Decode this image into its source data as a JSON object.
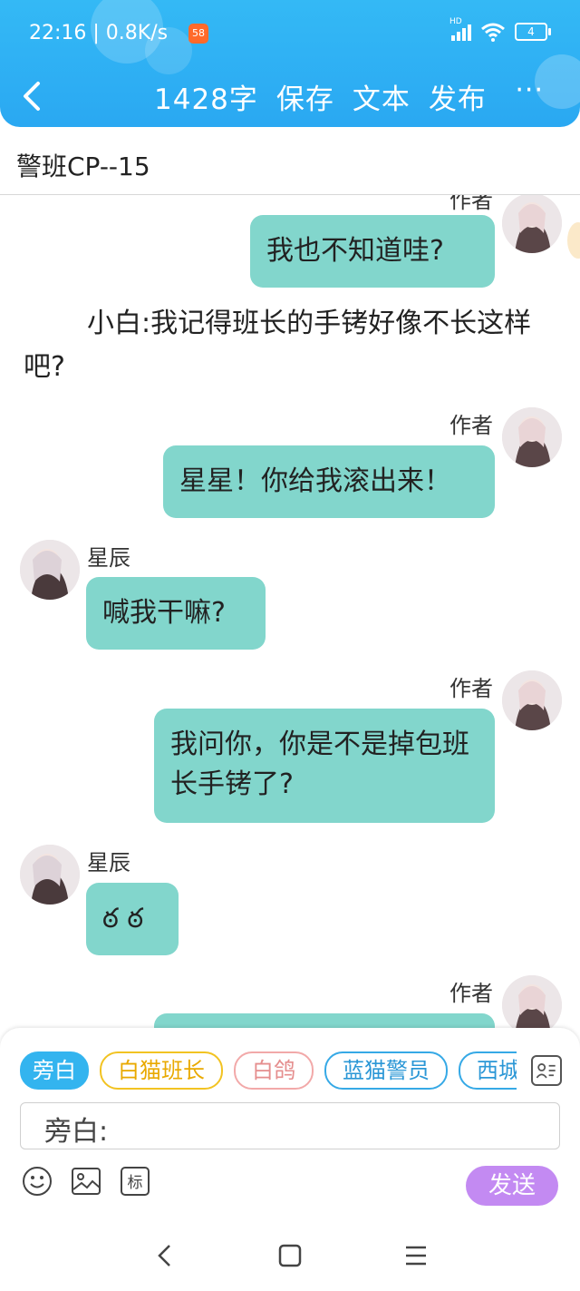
{
  "status_bar": {
    "time": "22:16 | 0.8K/s",
    "app_badge": "58",
    "hd": "HD",
    "battery": "4"
  },
  "toolbar": {
    "word_count": "1428字",
    "save": "保存",
    "text": "文本",
    "publish": "发布",
    "more": "···"
  },
  "title": "警班CP--15",
  "messages": [
    {
      "author": "作者",
      "text": "我也不知道哇?"
    },
    {
      "narration": "小白:我记得班长的手铐好像不长这样吧?"
    },
    {
      "author": "作者",
      "text": "星星！你给我滚出来！"
    },
    {
      "author": "星辰",
      "text": "喊我干嘛?"
    },
    {
      "author": "作者",
      "text": "我问你，你是不是掉包班长手铐了?"
    },
    {
      "author": "星辰",
      "text": "ఠ ఠ"
    },
    {
      "author": "作者",
      "text": ""
    }
  ],
  "roles": [
    "旁白",
    "白猫班长",
    "白鸽",
    "蓝猫警员",
    "西城"
  ],
  "input": {
    "prefix": "旁白:"
  },
  "tools": [
    "emoji-icon",
    "image-icon",
    "tag-icon"
  ],
  "tag_label": "标",
  "send": "发送",
  "colors": {
    "header": "#2aa8f2",
    "bubble": "#82d6cc",
    "send": "#c38af2",
    "active_role": "#33b4ef"
  }
}
